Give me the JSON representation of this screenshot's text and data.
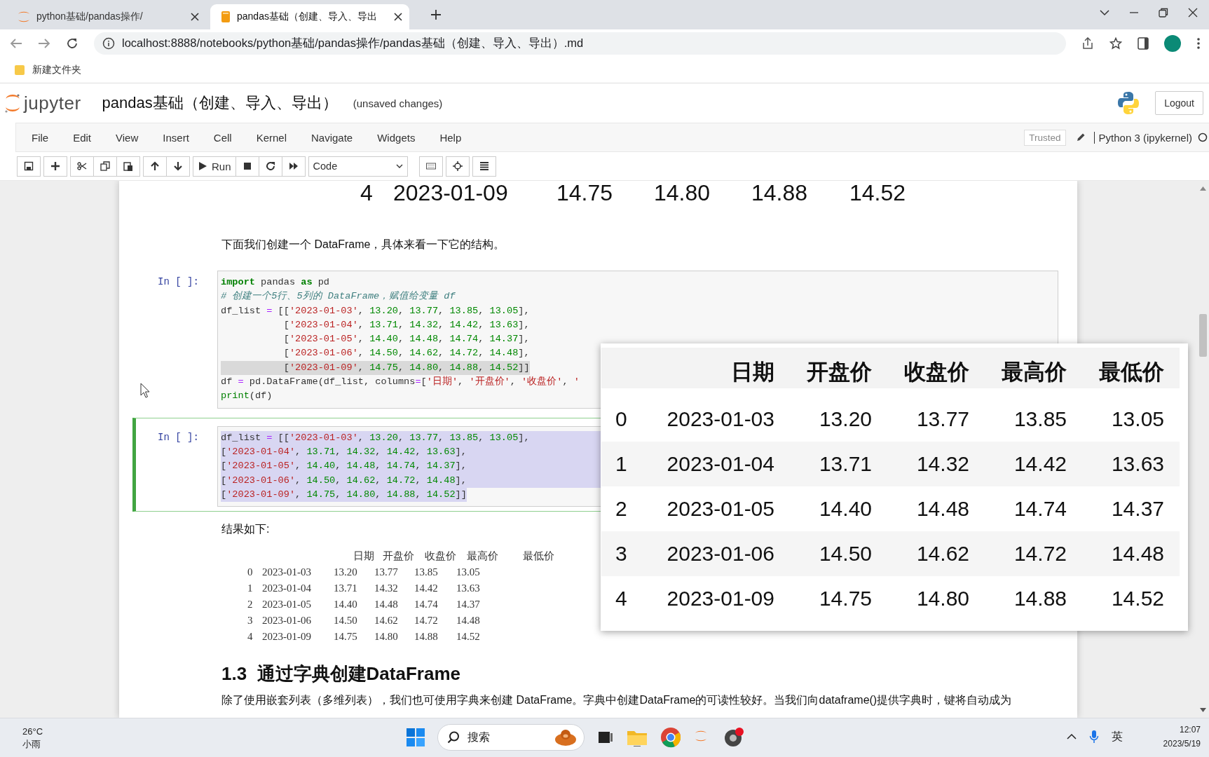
{
  "browser": {
    "tabs": [
      {
        "title": "python基础/pandas操作/",
        "selected": false
      },
      {
        "title": "pandas基础（创建、导入、导出",
        "selected": true
      }
    ],
    "url": "localhost:8888/notebooks/python基础/pandas操作/pandas基础（创建、导入、导出）.md",
    "bookmarks": [
      "新建文件夹"
    ]
  },
  "jupyter": {
    "logo_text": "jupyter",
    "title": "pandas基础（创建、导入、导出）",
    "status": "(unsaved changes)",
    "logout": "Logout",
    "menu": [
      "File",
      "Edit",
      "View",
      "Insert",
      "Cell",
      "Kernel",
      "Navigate",
      "Widgets",
      "Help"
    ],
    "trusted": "Trusted",
    "kernel": "Python 3 (ipykernel)",
    "run": "Run",
    "cell_type": "Code"
  },
  "notebook": {
    "prev_row": [
      "4",
      "2023-01-09",
      "14.75",
      "14.80",
      "14.88",
      "14.52"
    ],
    "cells": [
      {
        "kind": "markdown",
        "text": "下面我们创建一个 DataFrame，具体来看一下它的结构。"
      },
      {
        "kind": "code",
        "prompt": "In [ ]:",
        "selected": false,
        "lines": [
          {
            "selected": false,
            "tokens": [
              {
                "kind": "keyword",
                "text": "import"
              },
              {
                "kind": "plain",
                "text": " pandas "
              },
              {
                "kind": "keyword",
                "text": "as"
              },
              {
                "kind": "plain",
                "text": " pd"
              }
            ]
          },
          {
            "selected": false,
            "tokens": [
              {
                "kind": "comment",
                "text": "# 创建一个5行、5列的 DataFrame，赋值给变量 df"
              }
            ]
          },
          {
            "selected": false,
            "tokens": [
              {
                "kind": "plain",
                "text": "df_list "
              },
              {
                "kind": "operator",
                "text": "="
              },
              {
                "kind": "plain",
                "text": " [["
              },
              {
                "kind": "string",
                "text": "'2023-01-03'"
              },
              {
                "kind": "plain",
                "text": ", "
              },
              {
                "kind": "number",
                "text": "13.20"
              },
              {
                "kind": "plain",
                "text": ", "
              },
              {
                "kind": "number",
                "text": "13.77"
              },
              {
                "kind": "plain",
                "text": ", "
              },
              {
                "kind": "number",
                "text": "13.85"
              },
              {
                "kind": "plain",
                "text": ", "
              },
              {
                "kind": "number",
                "text": "13.05"
              },
              {
                "kind": "plain",
                "text": "],"
              }
            ]
          },
          {
            "selected": false,
            "tokens": [
              {
                "kind": "plain",
                "text": "           ["
              },
              {
                "kind": "string",
                "text": "'2023-01-04'"
              },
              {
                "kind": "plain",
                "text": ", "
              },
              {
                "kind": "number",
                "text": "13.71"
              },
              {
                "kind": "plain",
                "text": ", "
              },
              {
                "kind": "number",
                "text": "14.32"
              },
              {
                "kind": "plain",
                "text": ", "
              },
              {
                "kind": "number",
                "text": "14.42"
              },
              {
                "kind": "plain",
                "text": ", "
              },
              {
                "kind": "number",
                "text": "13.63"
              },
              {
                "kind": "plain",
                "text": "],"
              }
            ]
          },
          {
            "selected": false,
            "tokens": [
              {
                "kind": "plain",
                "text": "           ["
              },
              {
                "kind": "string",
                "text": "'2023-01-05'"
              },
              {
                "kind": "plain",
                "text": ", "
              },
              {
                "kind": "number",
                "text": "14.40"
              },
              {
                "kind": "plain",
                "text": ", "
              },
              {
                "kind": "number",
                "text": "14.48"
              },
              {
                "kind": "plain",
                "text": ", "
              },
              {
                "kind": "number",
                "text": "14.74"
              },
              {
                "kind": "plain",
                "text": ", "
              },
              {
                "kind": "number",
                "text": "14.37"
              },
              {
                "kind": "plain",
                "text": "],"
              }
            ]
          },
          {
            "selected": false,
            "tokens": [
              {
                "kind": "plain",
                "text": "           ["
              },
              {
                "kind": "string",
                "text": "'2023-01-06'"
              },
              {
                "kind": "plain",
                "text": ", "
              },
              {
                "kind": "number",
                "text": "14.50"
              },
              {
                "kind": "plain",
                "text": ", "
              },
              {
                "kind": "number",
                "text": "14.62"
              },
              {
                "kind": "plain",
                "text": ", "
              },
              {
                "kind": "number",
                "text": "14.72"
              },
              {
                "kind": "plain",
                "text": ", "
              },
              {
                "kind": "number",
                "text": "14.48"
              },
              {
                "kind": "plain",
                "text": "],"
              }
            ]
          },
          {
            "selected": true,
            "tokens": [
              {
                "kind": "plain",
                "text": "           ["
              },
              {
                "kind": "string",
                "text": "'2023-01-09'"
              },
              {
                "kind": "plain",
                "text": ", "
              },
              {
                "kind": "number",
                "text": "14.75"
              },
              {
                "kind": "plain",
                "text": ", "
              },
              {
                "kind": "number",
                "text": "14.80"
              },
              {
                "kind": "plain",
                "text": ", "
              },
              {
                "kind": "number",
                "text": "14.88"
              },
              {
                "kind": "plain",
                "text": ", "
              },
              {
                "kind": "number",
                "text": "14.52"
              },
              {
                "kind": "plain",
                "text": "]]"
              }
            ]
          },
          {
            "selected": false,
            "tokens": [
              {
                "kind": "plain",
                "text": "df "
              },
              {
                "kind": "operator",
                "text": "="
              },
              {
                "kind": "plain",
                "text": " pd.DataFrame(df_list, columns"
              },
              {
                "kind": "operator",
                "text": "="
              },
              {
                "kind": "plain",
                "text": "["
              },
              {
                "kind": "string",
                "text": "'日期'"
              },
              {
                "kind": "plain",
                "text": ", "
              },
              {
                "kind": "string",
                "text": "'开盘价'"
              },
              {
                "kind": "plain",
                "text": ", "
              },
              {
                "kind": "string",
                "text": "'收盘价'"
              },
              {
                "kind": "plain",
                "text": ", "
              },
              {
                "kind": "string",
                "text": "'"
              }
            ]
          },
          {
            "selected": false,
            "tokens": [
              {
                "kind": "builtin",
                "text": "print"
              },
              {
                "kind": "plain",
                "text": "(df)"
              }
            ]
          }
        ]
      },
      {
        "kind": "code",
        "prompt": "In [ ]:",
        "selected": true,
        "lines": [
          {
            "selected": true,
            "tokens": [
              {
                "kind": "plain",
                "text": "df_list "
              },
              {
                "kind": "operator",
                "text": "="
              },
              {
                "kind": "plain",
                "text": " [["
              },
              {
                "kind": "string",
                "text": "'2023-01-03'"
              },
              {
                "kind": "plain",
                "text": ", "
              },
              {
                "kind": "number",
                "text": "13.20"
              },
              {
                "kind": "plain",
                "text": ", "
              },
              {
                "kind": "number",
                "text": "13.77"
              },
              {
                "kind": "plain",
                "text": ", "
              },
              {
                "kind": "number",
                "text": "13.85"
              },
              {
                "kind": "plain",
                "text": ", "
              },
              {
                "kind": "number",
                "text": "13.05"
              },
              {
                "kind": "plain",
                "text": "],"
              }
            ]
          },
          {
            "selected": true,
            "tokens": [
              {
                "kind": "plain",
                "text": "["
              },
              {
                "kind": "string",
                "text": "'2023-01-04'"
              },
              {
                "kind": "plain",
                "text": ", "
              },
              {
                "kind": "number",
                "text": "13.71"
              },
              {
                "kind": "plain",
                "text": ", "
              },
              {
                "kind": "number",
                "text": "14.32"
              },
              {
                "kind": "plain",
                "text": ", "
              },
              {
                "kind": "number",
                "text": "14.42"
              },
              {
                "kind": "plain",
                "text": ", "
              },
              {
                "kind": "number",
                "text": "13.63"
              },
              {
                "kind": "plain",
                "text": "],"
              }
            ]
          },
          {
            "selected": true,
            "tokens": [
              {
                "kind": "plain",
                "text": "["
              },
              {
                "kind": "string",
                "text": "'2023-01-05'"
              },
              {
                "kind": "plain",
                "text": ", "
              },
              {
                "kind": "number",
                "text": "14.40"
              },
              {
                "kind": "plain",
                "text": ", "
              },
              {
                "kind": "number",
                "text": "14.48"
              },
              {
                "kind": "plain",
                "text": ", "
              },
              {
                "kind": "number",
                "text": "14.74"
              },
              {
                "kind": "plain",
                "text": ", "
              },
              {
                "kind": "number",
                "text": "14.37"
              },
              {
                "kind": "plain",
                "text": "],"
              }
            ]
          },
          {
            "selected": true,
            "tokens": [
              {
                "kind": "plain",
                "text": "["
              },
              {
                "kind": "string",
                "text": "'2023-01-06'"
              },
              {
                "kind": "plain",
                "text": ", "
              },
              {
                "kind": "number",
                "text": "14.50"
              },
              {
                "kind": "plain",
                "text": ", "
              },
              {
                "kind": "number",
                "text": "14.62"
              },
              {
                "kind": "plain",
                "text": ", "
              },
              {
                "kind": "number",
                "text": "14.72"
              },
              {
                "kind": "plain",
                "text": ", "
              },
              {
                "kind": "number",
                "text": "14.48"
              },
              {
                "kind": "plain",
                "text": "],"
              }
            ]
          },
          {
            "selected": true,
            "tokens": [
              {
                "kind": "plain",
                "text": "["
              },
              {
                "kind": "string",
                "text": "'2023-01-09'"
              },
              {
                "kind": "plain",
                "text": ", "
              },
              {
                "kind": "number",
                "text": "14.75"
              },
              {
                "kind": "plain",
                "text": ", "
              },
              {
                "kind": "number",
                "text": "14.80"
              },
              {
                "kind": "plain",
                "text": ", "
              },
              {
                "kind": "number",
                "text": "14.88"
              },
              {
                "kind": "plain",
                "text": ", "
              },
              {
                "kind": "number",
                "text": "14.52"
              },
              {
                "kind": "plain",
                "text": "]]"
              }
            ]
          }
        ]
      },
      {
        "kind": "markdown",
        "text": "结果如下:"
      },
      {
        "kind": "output",
        "columns": [
          "",
          "",
          "日期",
          "开盘价",
          "收盘价",
          "最高价",
          "最低价"
        ],
        "rows": [
          [
            "0",
            "2023-01-03",
            "13.20",
            "13.77",
            "13.85",
            "13.05"
          ],
          [
            "1",
            "2023-01-04",
            "13.71",
            "14.32",
            "14.42",
            "13.63"
          ],
          [
            "2",
            "2023-01-05",
            "14.40",
            "14.48",
            "14.74",
            "14.37"
          ],
          [
            "3",
            "2023-01-06",
            "14.50",
            "14.62",
            "14.72",
            "14.48"
          ],
          [
            "4",
            "2023-01-09",
            "14.75",
            "14.80",
            "14.88",
            "14.52"
          ]
        ]
      },
      {
        "kind": "heading",
        "text": "1.3  通过字典创建DataFrame"
      },
      {
        "kind": "markdown",
        "text": "除了使用嵌套列表（多维列表），我们也可使用字典来创建 DataFrame。字典中创建DataFrame的可读性较好。当我们向dataframe()提供字典时，键将自动成为"
      }
    ]
  },
  "popup": {
    "columns": [
      "",
      "日期",
      "开盘价",
      "收盘价",
      "最高价",
      "最低价"
    ],
    "rows": [
      [
        "0",
        "2023-01-03",
        "13.20",
        "13.77",
        "13.85",
        "13.05"
      ],
      [
        "1",
        "2023-01-04",
        "13.71",
        "14.32",
        "14.42",
        "13.63"
      ],
      [
        "2",
        "2023-01-05",
        "14.40",
        "14.48",
        "14.74",
        "14.37"
      ],
      [
        "3",
        "2023-01-06",
        "14.50",
        "14.62",
        "14.72",
        "14.48"
      ],
      [
        "4",
        "2023-01-09",
        "14.75",
        "14.80",
        "14.88",
        "14.52"
      ]
    ]
  },
  "taskbar": {
    "temperature": "26°C",
    "weather": "小雨",
    "search": {
      "placeholder": "搜索"
    },
    "ime": "英",
    "time": "12:07",
    "date": "2023/5/19"
  }
}
